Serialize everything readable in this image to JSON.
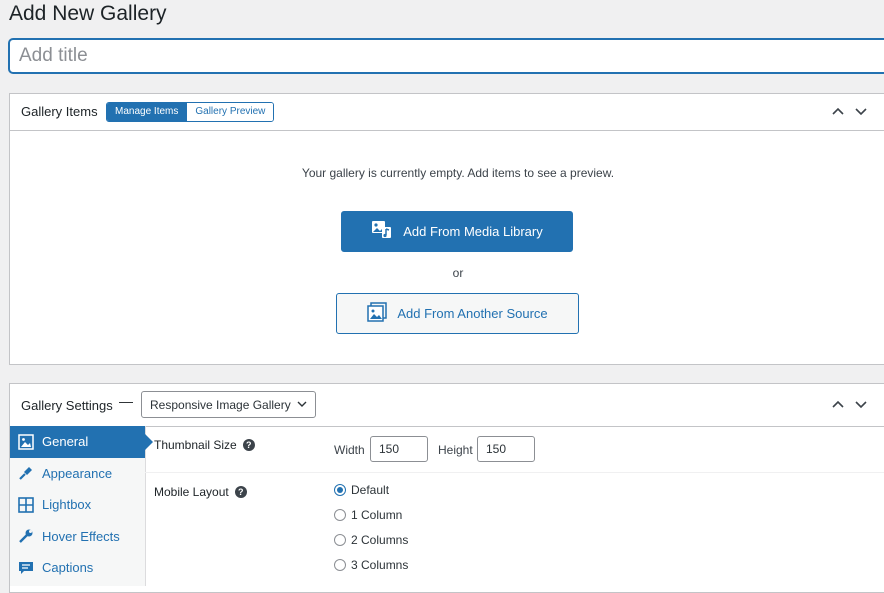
{
  "page": {
    "title": "Add New Gallery"
  },
  "title_input": {
    "placeholder": "Add title",
    "value": ""
  },
  "gallery_items": {
    "title": "Gallery Items",
    "tabs": {
      "manage": "Manage Items",
      "preview": "Gallery Preview"
    },
    "empty_message": "Your gallery is currently empty. Add items to see a preview.",
    "add_media_label": "Add From Media Library",
    "or_label": "or",
    "add_source_label": "Add From Another Source"
  },
  "gallery_settings": {
    "title": "Gallery Settings",
    "dash": "—",
    "template_select": "Responsive Image Gallery",
    "nav": [
      {
        "label": "General",
        "icon": "image-icon",
        "active": true
      },
      {
        "label": "Appearance",
        "icon": "brush-icon",
        "active": false
      },
      {
        "label": "Lightbox",
        "icon": "grid-icon",
        "active": false
      },
      {
        "label": "Hover Effects",
        "icon": "wrench-icon",
        "active": false
      },
      {
        "label": "Captions",
        "icon": "caption-icon",
        "active": false
      }
    ],
    "thumbnail": {
      "label": "Thumbnail Size",
      "width_label": "Width",
      "width_value": "150",
      "height_label": "Height",
      "height_value": "150"
    },
    "mobile_layout": {
      "label": "Mobile Layout",
      "options": [
        "Default",
        "1 Column",
        "2 Columns",
        "3 Columns"
      ],
      "selected": "Default"
    }
  },
  "colors": {
    "accent": "#2271b1",
    "border": "#c3c4c7",
    "background": "#f0f0f1"
  }
}
